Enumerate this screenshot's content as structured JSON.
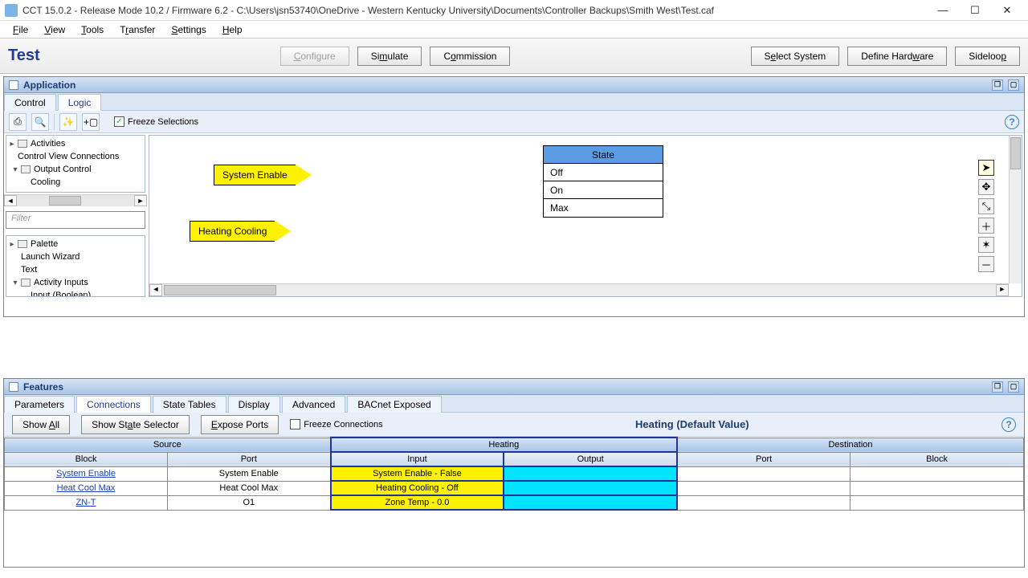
{
  "window": {
    "title": "CCT 15.0.2 - Release Mode 10.2 / Firmware 6.2 - C:\\Users\\jsn53740\\OneDrive - Western Kentucky University\\Documents\\Controller Backups\\Smith West\\Test.caf"
  },
  "menu": {
    "items": [
      "File",
      "View",
      "Tools",
      "Transfer",
      "Settings",
      "Help"
    ]
  },
  "header": {
    "heading": "Test",
    "center_buttons": [
      "Configure",
      "Simulate",
      "Commission"
    ],
    "disabled_center_index": 0,
    "right_buttons": [
      "Select System",
      "Define Hardware",
      "Sideloop"
    ]
  },
  "app_panel": {
    "title": "Application",
    "tabs": [
      "Control",
      "Logic"
    ],
    "active_tab_index": 1,
    "freeze_label": "Freeze Selections",
    "freeze_checked": true,
    "tree": {
      "items": [
        "Activities",
        "Control View Connections",
        "Output Control",
        "Cooling"
      ]
    },
    "filter_placeholder": "Filter",
    "palette": {
      "title": "Palette",
      "items": [
        "Launch Wizard",
        "Text",
        "Activity Inputs",
        "Input (Boolean)"
      ]
    },
    "canvas": {
      "block1": "System Enable",
      "block2": "Heating Cooling",
      "state_header": "State",
      "state_rows": [
        "Off",
        "On",
        "Max"
      ]
    }
  },
  "features_panel": {
    "title": "Features",
    "tabs": [
      "Parameters",
      "Connections",
      "State Tables",
      "Display",
      "Advanced",
      "BACnet Exposed"
    ],
    "active_tab_index": 1,
    "buttons": [
      "Show All",
      "Show State Selector",
      "Expose Ports"
    ],
    "freeze_label": "Freeze Connections",
    "freeze_checked": false,
    "center_label": "Heating (Default Value)",
    "table": {
      "group_headers": [
        "Source",
        "Heating",
        "Destination"
      ],
      "sub_headers": [
        "Block",
        "Port",
        "Input",
        "Output",
        "Port",
        "Block"
      ],
      "rows": [
        {
          "block": "System Enable",
          "port": "System Enable",
          "input": "System Enable - False",
          "output": "",
          "dport": "",
          "dblock": ""
        },
        {
          "block": "Heat Cool Max",
          "port": "Heat Cool Max",
          "input": "Heating Cooling - Off",
          "output": "",
          "dport": "",
          "dblock": ""
        },
        {
          "block": "ZN-T",
          "port": "O1",
          "input": "Zone Temp - 0.0",
          "output": "",
          "dport": "",
          "dblock": ""
        }
      ]
    }
  }
}
